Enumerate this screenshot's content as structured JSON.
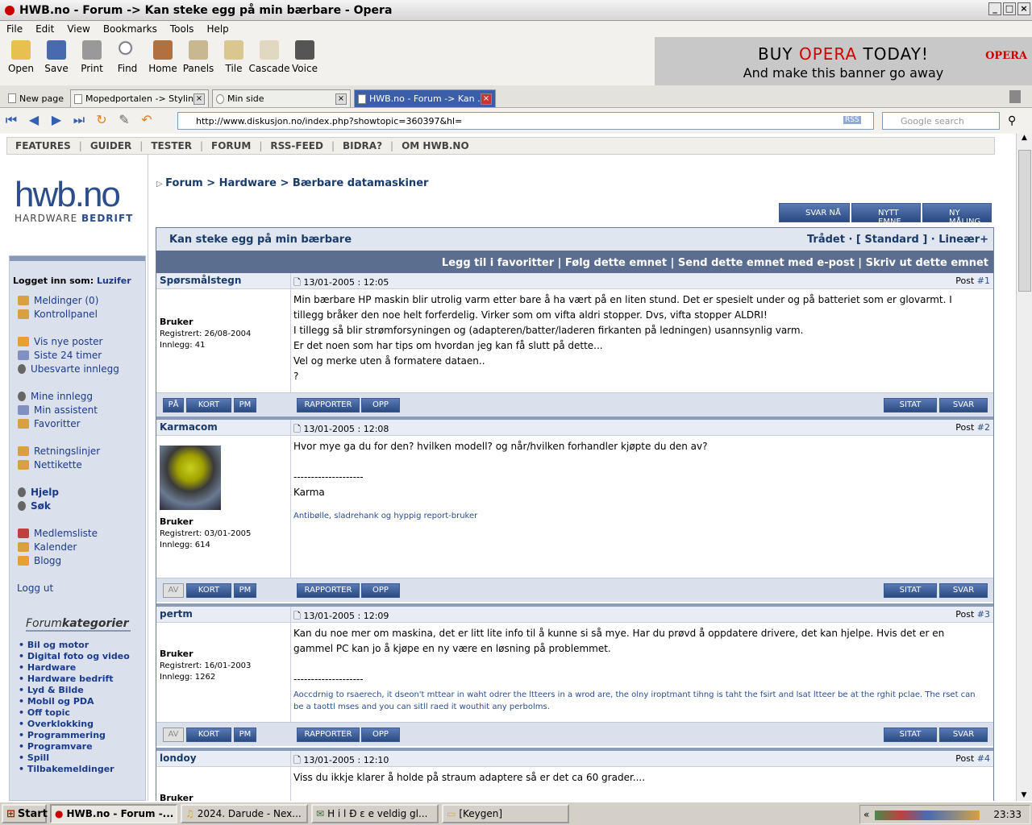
{
  "window": {
    "title": "HWB.no - Forum -> Kan steke egg på min bærbare - Opera"
  },
  "menu": [
    "File",
    "Edit",
    "View",
    "Bookmarks",
    "Tools",
    "Help"
  ],
  "toolbar": [
    "Open",
    "Save",
    "Print",
    "Find",
    "Home",
    "Panels",
    "Tile",
    "Cascade",
    "Voice"
  ],
  "banner": {
    "line1a": "BUY ",
    "line1b": "OPERA",
    "line1c": " TODAY!",
    "line2": "And make this banner go away",
    "logo": "OPERA"
  },
  "tabs": {
    "new_page": "New page",
    "items": [
      "Mopedportalen -> Styling",
      "Min side",
      "HWB.no - Forum -> Kan ..."
    ]
  },
  "address": {
    "url": "http://www.diskusjon.no/index.php?showtopic=360397&hl=",
    "rss": "RSS",
    "search_placeholder": "Google search"
  },
  "topnav": [
    "FEATURES",
    "GUIDER",
    "TESTER",
    "FORUM",
    "RSS-FEED",
    "BIDRA?",
    "OM HWB.NO"
  ],
  "logo": {
    "name": "hwb.no",
    "sub1": "HARDWARE ",
    "sub2": "BEDRIFT"
  },
  "sidebar": {
    "logged_in": "Logget inn som: ",
    "user": "Luzifer",
    "links": [
      "Meldinger (0)",
      "Kontrollpanel",
      "Vis nye poster",
      "Siste 24 timer",
      "Ubesvarte innlegg",
      "Mine innlegg",
      "Min assistent",
      "Favoritter",
      "Retningslinjer",
      "Nettikette",
      "Hjelp",
      "Søk",
      "Medlemsliste",
      "Kalender",
      "Blogg"
    ],
    "logout": "Logg ut",
    "cat_title1": "Forum",
    "cat_title2": "kategorier",
    "categories": [
      "• Bil og motor",
      "• Digital foto og video",
      "• Hardware",
      "• Hardware bedrift",
      "• Lyd & Bilde",
      "• Mobil og PDA",
      "• Off topic",
      "• Overklokking",
      "• Programmering",
      "• Programvare",
      "• Spill",
      "• Tilbakemeldinger"
    ]
  },
  "breadcrumb": "Forum > Hardware > Bærbare datamaskiner",
  "actions": [
    "SVAR NÅ",
    "NYTT EMNE",
    "NY MÅLING"
  ],
  "thread": {
    "title": "Kan steke egg på min bærbare",
    "modes": "Trådet · [ Standard ] · Lineær+",
    "bar": "Legg til i favoritter | Følg dette emnet | Send dette emnet med e-post | Skriv ut dette emnet"
  },
  "buttons": {
    "on": "PÅ",
    "off": "AV",
    "kort": "KORT",
    "pm": "PM",
    "rapporter": "RAPPORTER",
    "opp": "OPP",
    "sitat": "SITAT",
    "svar": "SVAR"
  },
  "posts": [
    {
      "name": "Spørsmålstegn",
      "date": "13/01-2005 : 12:05",
      "num_prefix": "Post ",
      "num": "#1",
      "role": "Bruker",
      "reg": "Registrert: 26/08-2004",
      "posts": "Innlegg: 41",
      "body": [
        "Min bærbare HP maskin blir utrolig varm etter bare å ha vært på en liten stund. Det er spesielt under og på batteriet som er glovarmt. I",
        "tillegg bråker den noe helt forferdelig. Virker som om vifta aldri stopper. Dvs, vifta stopper ALDRI!",
        "I tillegg så blir strømforsyningen og (adapteren/batter/laderen firkanten på ledningen) usannsynlig varm.",
        "Er det noen som har tips om hvordan jeg kan få slutt på dette...",
        "Vel og merke uten å formatere dataen..",
        "?"
      ]
    },
    {
      "name": "Karmacom",
      "date": "13/01-2005 : 12:08",
      "num_prefix": "Post ",
      "num": "#2",
      "role": "Bruker",
      "reg": "Registrert: 03/01-2005",
      "posts": "Innlegg: 614",
      "body": [
        "Hvor mye ga du for den? hvilken modell? og når/hvilken forhandler kjøpte du den av?",
        "",
        "--------------------",
        "Karma"
      ],
      "sig": "Antibølle, sladrehank og hyppig report-bruker"
    },
    {
      "name": "pertm",
      "date": "13/01-2005 : 12:09",
      "num_prefix": "Post ",
      "num": "#3",
      "role": "Bruker",
      "reg": "Registrert: 16/01-2003",
      "posts": "Innlegg: 1262",
      "body": [
        "Kan du noe mer om maskina, det er litt lite info til å kunne si så mye. Har du prøvd å oppdatere drivere, det kan hjelpe. Hvis det er en",
        "gammel PC kan jo å kjøpe en ny være en løsning på problemmet.",
        "",
        "--------------------"
      ],
      "sig": "Aoccdrnig to rsaerech, it dseon't mttear in waht odrer the ltteers in a wrod are, the olny iroptmant tihng is taht the fsirt and lsat ltteer be at the rghit pclae. The rset can be a taottl mses and you can sitll raed it wouthit any perbolms."
    },
    {
      "name": "londoy",
      "date": "13/01-2005 : 12:10",
      "num_prefix": "Post ",
      "num": "#4",
      "role": "Bruker",
      "body": [
        "Viss du ikkje klarer å holde på straum adaptere så er det ca 60 grader...."
      ]
    }
  ],
  "taskbar": {
    "start": "Start",
    "tasks": [
      "HWB.no - Forum -...",
      "2024. Darude - Nex...",
      "H i l Ð ε  e veldig gl...",
      "[Keygen]"
    ],
    "clock": "23:33",
    "tray_arrow": "«"
  }
}
